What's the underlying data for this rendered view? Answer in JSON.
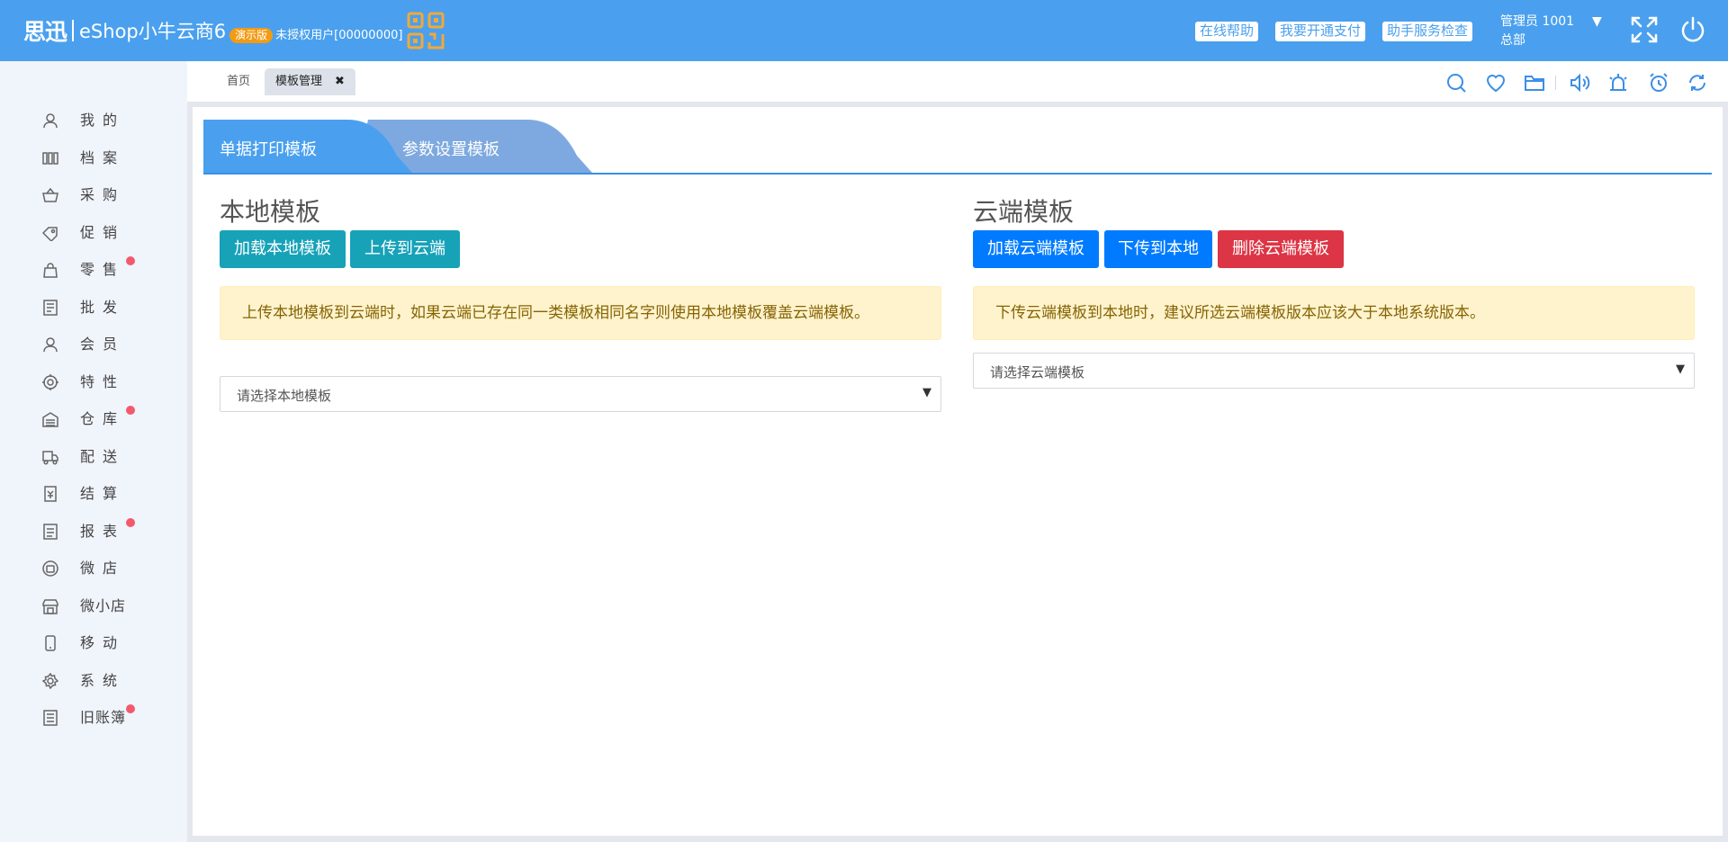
{
  "header": {
    "logo": "思迅",
    "product": "eShop小牛云商6",
    "demo_badge": "演示版",
    "unauthorized_user": "未授权用户[00000000]",
    "links": [
      "在线帮助",
      "我要开通支付",
      "助手服务检查"
    ],
    "user_name": "管理员 1001",
    "user_branch": "总部",
    "user_caret": "▼"
  },
  "sidebar": {
    "items": [
      {
        "label": "我的",
        "icon": "user-icon",
        "dot": false
      },
      {
        "label": "档案",
        "icon": "archive-icon",
        "dot": false
      },
      {
        "label": "采购",
        "icon": "basket-icon",
        "dot": false
      },
      {
        "label": "促销",
        "icon": "tag-icon",
        "dot": false
      },
      {
        "label": "零售",
        "icon": "shopping-bag-icon",
        "dot": true
      },
      {
        "label": "批发",
        "icon": "invoice-icon",
        "dot": false
      },
      {
        "label": "会员",
        "icon": "member-icon",
        "dot": false
      },
      {
        "label": "特性",
        "icon": "target-icon",
        "dot": false
      },
      {
        "label": "仓库",
        "icon": "warehouse-icon",
        "dot": true
      },
      {
        "label": "配送",
        "icon": "truck-icon",
        "dot": false
      },
      {
        "label": "结算",
        "icon": "settlement-icon",
        "dot": false
      },
      {
        "label": "报表",
        "icon": "report-icon",
        "dot": true
      },
      {
        "label": "微店",
        "icon": "wechat-store-icon",
        "dot": false
      },
      {
        "label": "微小店",
        "icon": "mini-store-icon",
        "dot": false
      },
      {
        "label": "移动",
        "icon": "mobile-icon",
        "dot": false
      },
      {
        "label": "系统",
        "icon": "gear-icon",
        "dot": false
      },
      {
        "label": "旧账簿",
        "icon": "ledger-icon",
        "dot": true
      }
    ]
  },
  "tabs": {
    "home": "首页",
    "active": "模板管理",
    "close": "✖"
  },
  "subtabs": [
    "单据打印模板",
    "参数设置模板"
  ],
  "local": {
    "title": "本地模板",
    "load_button": "加载本地模板",
    "upload_button": "上传到云端",
    "alert": "上传本地模板到云端时，如果云端已存在同一类模板相同名字则使用本地模板覆盖云端模板。",
    "select_placeholder": "请选择本地模板"
  },
  "cloud": {
    "title": "云端模板",
    "load_button": "加载云端模板",
    "download_button": "下传到本地",
    "delete_button": "删除云端模板",
    "alert": "下传云端模板到本地时，建议所选云端模板版本应该大于本地系统版本。",
    "select_placeholder": "请选择云端模板"
  },
  "select_caret": "▼",
  "colors": {
    "header_bg": "#4aa0ee",
    "accent": "#3c8fe6",
    "demo_badge": "#f39b12",
    "teal": "#17a2b8",
    "blue": "#007bff",
    "red": "#dc3545",
    "badge_dot": "#f25a6c"
  }
}
